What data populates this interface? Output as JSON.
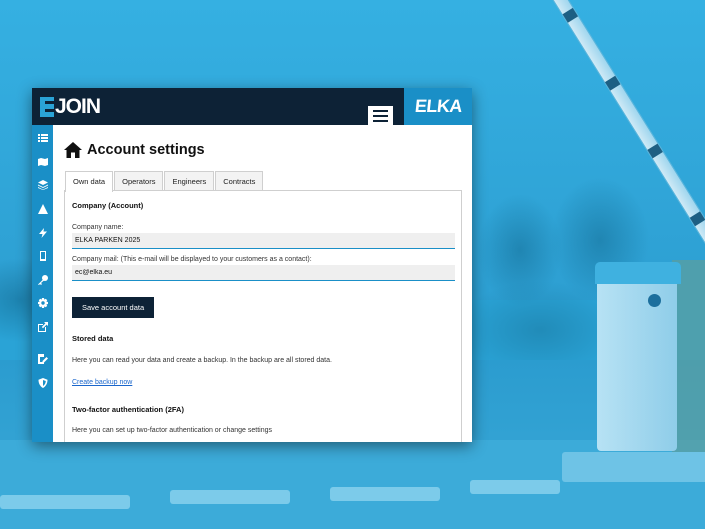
{
  "app": {
    "logo_text": "JOIN",
    "brand": "ELKA"
  },
  "page": {
    "title": "Account settings"
  },
  "tabs": [
    {
      "label": "Own data",
      "active": true
    },
    {
      "label": "Operators",
      "active": false
    },
    {
      "label": "Engineers",
      "active": false
    },
    {
      "label": "Contracts",
      "active": false
    }
  ],
  "company": {
    "heading": "Company (Account)",
    "name_label": "Company name:",
    "name_value": "ELKA PARKEN 2025",
    "mail_label": "Company mail: (This e-mail will be displayed to your customers as a contact):",
    "mail_value": "ec@elka.eu",
    "save_label": "Save account data"
  },
  "stored": {
    "heading": "Stored data",
    "text": "Here you can read your data and create a backup. In the backup are all stored data.",
    "link": "Create backup now"
  },
  "twofa": {
    "heading": "Two-factor authentication (2FA)",
    "text": "Here you can set up two-factor authentication or change settings"
  },
  "sidebar_icons": [
    "list-icon",
    "map-icon",
    "layers-icon",
    "warning-icon",
    "bolt-icon",
    "mobile-icon",
    "key-icon",
    "gear-icon",
    "external-link-icon",
    "edit-document-icon",
    "shield-icon"
  ],
  "colors": {
    "topbar": "#0d2236",
    "accent": "#1a8fc7",
    "button": "#0d2236",
    "link": "#1a66cc"
  }
}
